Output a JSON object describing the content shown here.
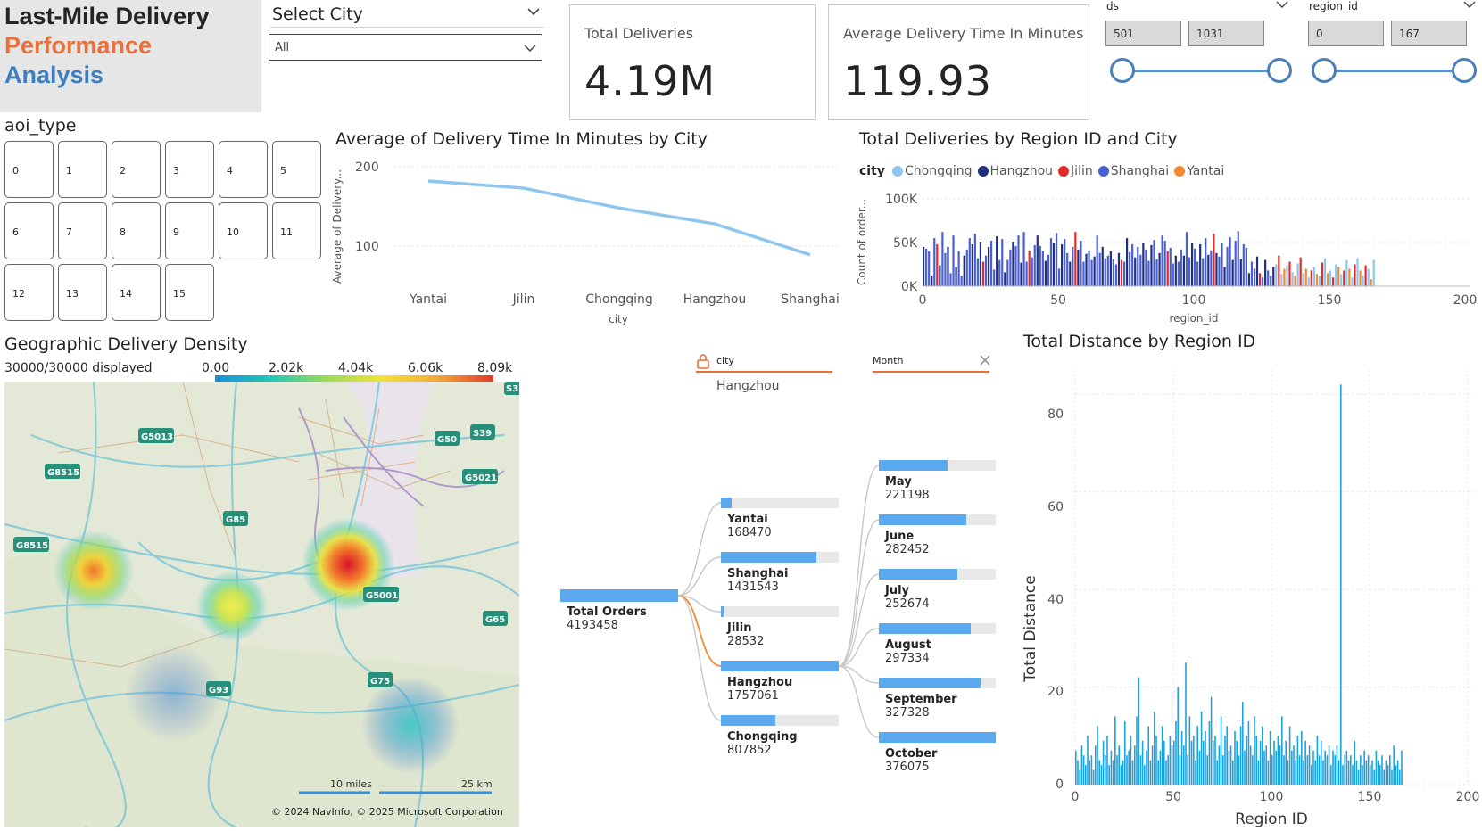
{
  "title": {
    "line1": "Last-Mile Delivery",
    "line2": "Performance",
    "line3": "Analysis"
  },
  "city_slicer": {
    "label": "Select City",
    "selected": "All"
  },
  "kpi_total": {
    "label": "Total Deliveries",
    "value": "4.19M"
  },
  "kpi_avg": {
    "label": "Average Delivery Time In Minutes",
    "value": "119.93"
  },
  "ds_slider": {
    "label": "ds",
    "min": "501",
    "max": "1031"
  },
  "region_slider": {
    "label": "region_id",
    "min": "0",
    "max": "167"
  },
  "aoi": {
    "title": "aoi_type",
    "options": [
      "0",
      "1",
      "2",
      "3",
      "4",
      "5",
      "6",
      "7",
      "8",
      "9",
      "10",
      "11",
      "12",
      "13",
      "14",
      "15"
    ]
  },
  "line_chart": {
    "title": "Average of Delivery Time In Minutes by City",
    "ylabel": "Average of Delivery...",
    "xlabel": "city",
    "yticks": [
      "200",
      "100"
    ]
  },
  "region_chart": {
    "title": "Total Deliveries by Region ID and City",
    "legend_title": "city",
    "ylabel": "Count of order...",
    "xlabel": "region_id",
    "yticks": [
      "100K",
      "50K",
      "0K"
    ],
    "xticks": [
      "0",
      "50",
      "100",
      "150",
      "200"
    ]
  },
  "map": {
    "title": "Geographic Delivery Density",
    "displayed": "30000/30000 displayed",
    "legend": [
      "0.00",
      "2.02k",
      "4.04k",
      "6.06k",
      "8.09k"
    ],
    "copyright": "© 2024 NavInfo, © 2025 Microsoft Corporation",
    "scale_miles": "10 miles",
    "scale_km": "25 km",
    "road_labels": [
      "G5013",
      "G8515",
      "G85",
      "G8515",
      "G50",
      "S39",
      "G5021",
      "G5001",
      "G65",
      "G75",
      "G93",
      "S3"
    ]
  },
  "decomp": {
    "filter1_label": "city",
    "filter1_value": "Hangzhou",
    "filter2_label": "Month",
    "root": {
      "label": "Total Orders",
      "value": "4193458"
    },
    "cities": [
      {
        "label": "Yantai",
        "value": "168470",
        "frac": 0.09
      },
      {
        "label": "Shanghai",
        "value": "1431543",
        "frac": 0.81
      },
      {
        "label": "Jilin",
        "value": "28532",
        "frac": 0.015
      },
      {
        "label": "Hangzhou",
        "value": "1757061",
        "frac": 1.0
      },
      {
        "label": "Chongqing",
        "value": "807852",
        "frac": 0.46
      }
    ],
    "months": [
      {
        "label": "May",
        "value": "221198",
        "frac": 0.59
      },
      {
        "label": "June",
        "value": "282452",
        "frac": 0.75
      },
      {
        "label": "July",
        "value": "252674",
        "frac": 0.67
      },
      {
        "label": "August",
        "value": "297334",
        "frac": 0.79
      },
      {
        "label": "September",
        "value": "327328",
        "frac": 0.87
      },
      {
        "label": "October",
        "value": "376075",
        "frac": 1.0
      }
    ]
  },
  "distance_chart": {
    "title": "Total Distance by Region ID",
    "ylabel": "Total Distance",
    "xlabel": "Region ID",
    "yticks": [
      "80",
      "60",
      "40",
      "20",
      "0"
    ],
    "xticks": [
      "0",
      "50",
      "100",
      "150",
      "200"
    ]
  },
  "chart_data": [
    {
      "type": "line",
      "title": "Average of Delivery Time In Minutes by City",
      "xlabel": "city",
      "ylabel": "Average of Delivery...",
      "categories": [
        "Yantai",
        "Jilin",
        "Chongqing",
        "Hangzhou",
        "Shanghai"
      ],
      "values": [
        182,
        173,
        148,
        128,
        89
      ],
      "ylim": [
        60,
        220
      ],
      "color": "#8ec6f0"
    },
    {
      "type": "bar",
      "title": "Total Deliveries by Region ID and City",
      "xlabel": "region_id",
      "ylabel": "Count of order...",
      "xlim": [
        0,
        200
      ],
      "ylim": [
        0,
        100000
      ],
      "series": [
        {
          "name": "Chongqing",
          "color": "#8ec6f0"
        },
        {
          "name": "Hangzhou",
          "color": "#1f2f7a"
        },
        {
          "name": "Jilin",
          "color": "#e22a2a"
        },
        {
          "name": "Shanghai",
          "color": "#4a5fd0"
        },
        {
          "name": "Yantai",
          "color": "#f28a2e"
        }
      ],
      "values": [
        45000,
        43000,
        40000,
        12000,
        55000,
        48000,
        24000,
        62000,
        38000,
        45000,
        15000,
        58000,
        22000,
        40000,
        12000,
        35000,
        42000,
        55000,
        48000,
        60000,
        32000,
        51000,
        28000,
        35000,
        45000,
        52000,
        19000,
        57000,
        30000,
        54000,
        16000,
        30000,
        42000,
        51000,
        46000,
        58000,
        27000,
        62000,
        28000,
        41000,
        33000,
        47000,
        58000,
        46000,
        40000,
        29000,
        36000,
        55000,
        50000,
        61000,
        20000,
        48000,
        54000,
        38000,
        28000,
        45000,
        62000,
        42000,
        52000,
        28000,
        37000,
        41000,
        30000,
        34000,
        58000,
        38000,
        45000,
        32000,
        35000,
        40000,
        31000,
        25000,
        38000,
        30000,
        28000,
        55000,
        39000,
        48000,
        33000,
        45000,
        36000,
        50000,
        42000,
        29000,
        47000,
        53000,
        31000,
        38000,
        58000,
        52000,
        40000,
        44000,
        26000,
        35000,
        28000,
        42000,
        35000,
        62000,
        33000,
        50000,
        43000,
        28000,
        48000,
        32000,
        55000,
        36000,
        41000,
        60000,
        38000,
        34000,
        50000,
        22000,
        45000,
        56000,
        30000,
        52000,
        63000,
        31000,
        48000,
        44000,
        15000,
        28000,
        20000,
        34000,
        15000,
        10000,
        30000,
        18000,
        12000,
        22000,
        25000,
        35000,
        14000,
        20000,
        24000,
        28000,
        16000,
        12000,
        26000,
        33000,
        15000,
        20000,
        10000,
        18000,
        22000,
        14000,
        12000,
        27000,
        32000,
        15000,
        18000,
        10000,
        25000,
        22000,
        14000,
        18000,
        30000,
        20000,
        10000,
        25000,
        32000,
        18000,
        12000,
        24000,
        20000,
        8000,
        30000
      ],
      "colors_by_index": true
    },
    {
      "type": "bar",
      "title": "Total Distance by Region ID",
      "xlabel": "Region ID",
      "ylabel": "Total Distance",
      "xlim": [
        0,
        200
      ],
      "ylim": [
        0,
        85
      ],
      "color": "#1aa3e0",
      "values": [
        7,
        5,
        3,
        8,
        6,
        4,
        10,
        5,
        6,
        3,
        8,
        12,
        5,
        4,
        9,
        6,
        10,
        4,
        7,
        5,
        14,
        6,
        8,
        4,
        5,
        13,
        6,
        7,
        10,
        5,
        8,
        14,
        22,
        6,
        9,
        4,
        7,
        12,
        5,
        8,
        15,
        10,
        5,
        7,
        12,
        9,
        5,
        6,
        10,
        8,
        9,
        13,
        20,
        6,
        11,
        8,
        25,
        6,
        14,
        9,
        10,
        5,
        12,
        7,
        15,
        9,
        11,
        6,
        13,
        18,
        9,
        10,
        5,
        8,
        14,
        6,
        10,
        12,
        7,
        8,
        5,
        11,
        9,
        6,
        12,
        17,
        7,
        10,
        13,
        8,
        6,
        14,
        10,
        5,
        9,
        12,
        7,
        8,
        5,
        11,
        6,
        9,
        7,
        10,
        8,
        14,
        6,
        9,
        5,
        12,
        7,
        8,
        5,
        10,
        6,
        11,
        5,
        9,
        6,
        8,
        4,
        7,
        5,
        10,
        6,
        9,
        5,
        7,
        6,
        8,
        4,
        7,
        6,
        8,
        5,
        82,
        4,
        6,
        7,
        5,
        6,
        4,
        9,
        5,
        3,
        6,
        4,
        7,
        5,
        6,
        4,
        5,
        3,
        7,
        5,
        4,
        6,
        3,
        5,
        4,
        6,
        3,
        8,
        4,
        5,
        3,
        7
      ]
    }
  ]
}
